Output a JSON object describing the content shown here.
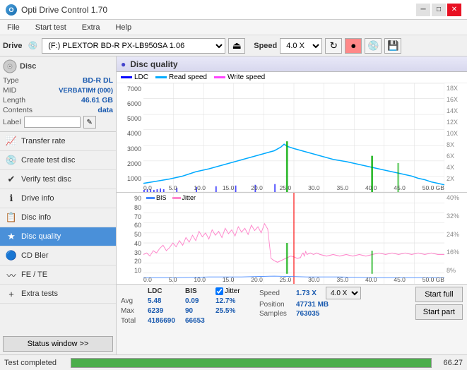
{
  "app": {
    "title": "Opti Drive Control 1.70",
    "icon": "●"
  },
  "titleControls": {
    "minimize": "─",
    "maximize": "□",
    "close": "✕"
  },
  "menu": {
    "items": [
      "File",
      "Start test",
      "Extra",
      "Help"
    ]
  },
  "driveToolbar": {
    "label": "Drive",
    "driveValue": "(F:) PLEXTOR BD-R PX-LB950SA 1.06",
    "speedLabel": "Speed",
    "speedValue": "4.0 X"
  },
  "disc": {
    "title": "Disc",
    "type_label": "Type",
    "type_value": "BD-R DL",
    "mid_label": "MID",
    "mid_value": "VERBATIMf (000)",
    "length_label": "Length",
    "length_value": "46.61 GB",
    "contents_label": "Contents",
    "contents_value": "data",
    "label_label": "Label"
  },
  "nav": {
    "items": [
      {
        "id": "transfer-rate",
        "label": "Transfer rate",
        "icon": "📈"
      },
      {
        "id": "create-test-disc",
        "label": "Create test disc",
        "icon": "💿"
      },
      {
        "id": "verify-test-disc",
        "label": "Verify test disc",
        "icon": "✔"
      },
      {
        "id": "drive-info",
        "label": "Drive info",
        "icon": "ℹ"
      },
      {
        "id": "disc-info",
        "label": "Disc info",
        "icon": "📋"
      },
      {
        "id": "disc-quality",
        "label": "Disc quality",
        "icon": "★",
        "active": true
      },
      {
        "id": "cd-bler",
        "label": "CD Bler",
        "icon": "🔵"
      },
      {
        "id": "fe-te",
        "label": "FE / TE",
        "icon": "〰"
      },
      {
        "id": "extra-tests",
        "label": "Extra tests",
        "icon": "+"
      }
    ]
  },
  "statusBtn": "Status window >>",
  "status": {
    "text": "Test completed",
    "progress": 100,
    "value": "66.27"
  },
  "chart": {
    "title": "Disc quality",
    "icon": "●",
    "legend": {
      "ldc": "LDC",
      "read": "Read speed",
      "write": "Write speed"
    },
    "topYAxis": [
      "7000",
      "6000",
      "5000",
      "4000",
      "3000",
      "2000",
      "1000"
    ],
    "topYAxisRight": [
      "18X",
      "16X",
      "14X",
      "12X",
      "10X",
      "8X",
      "6X",
      "4X",
      "2X"
    ],
    "xAxis": [
      "0.0",
      "5.0",
      "10.0",
      "15.0",
      "20.0",
      "25.0",
      "30.0",
      "35.0",
      "40.0",
      "45.0",
      "50.0 GB"
    ],
    "bottomLegend": {
      "bis": "BIS",
      "jitter": "Jitter"
    },
    "bottomYAxis": [
      "90",
      "80",
      "70",
      "60",
      "50",
      "40",
      "30",
      "20",
      "10"
    ],
    "bottomYAxisRight": [
      "40%",
      "32%",
      "24%",
      "16%",
      "8%"
    ]
  },
  "stats": {
    "ldc_label": "LDC",
    "bis_label": "BIS",
    "jitter_checked": true,
    "jitter_label": "Jitter",
    "speed_label": "Speed",
    "speed_value": "1.73 X",
    "speed_select": "4.0 X",
    "avg_label": "Avg",
    "avg_ldc": "5.48",
    "avg_bis": "0.09",
    "avg_jitter": "12.7%",
    "max_label": "Max",
    "max_ldc": "6239",
    "max_bis": "90",
    "max_jitter": "25.5%",
    "total_label": "Total",
    "total_ldc": "4186690",
    "total_bis": "66653",
    "position_label": "Position",
    "position_value": "47731 MB",
    "samples_label": "Samples",
    "samples_value": "763035",
    "start_full": "Start full",
    "start_part": "Start part"
  }
}
